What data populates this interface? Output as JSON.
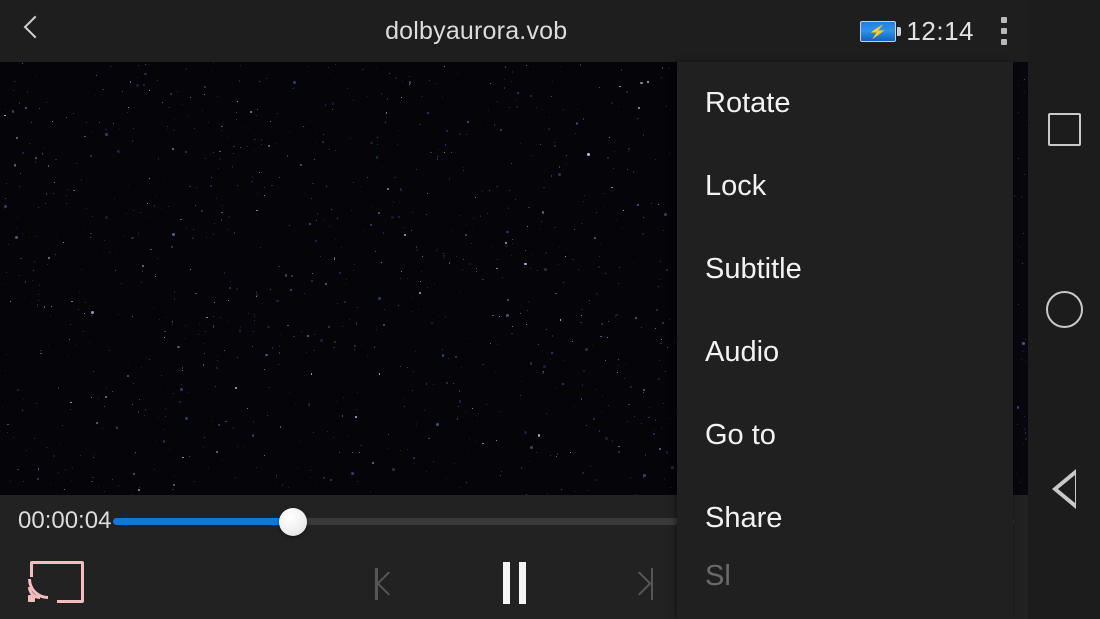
{
  "topbar": {
    "back_icon": "chevron-left-icon",
    "title": "dolbyaurora.vob",
    "battery_icon": "battery-charging-icon",
    "battery_bolt": "⚡",
    "clock": "12:14",
    "overflow_icon": "kebab-menu-icon"
  },
  "player": {
    "current_time": "00:00:04",
    "progress_percent": 20,
    "cast_icon": "cast-icon",
    "previous_icon": "skip-previous-icon",
    "pause_icon": "pause-icon",
    "next_icon": "skip-next-icon",
    "accent_color": "#1278d4",
    "cast_color": "#f3bdbd"
  },
  "menu": {
    "items": [
      {
        "label": "Rotate"
      },
      {
        "label": "Lock"
      },
      {
        "label": "Subtitle"
      },
      {
        "label": "Audio"
      },
      {
        "label": "Go to"
      },
      {
        "label": "Share"
      },
      {
        "label": "Sl"
      }
    ]
  },
  "navbar": {
    "recents_icon": "square-recents-icon",
    "home_icon": "circle-home-icon",
    "back_icon": "triangle-back-icon"
  },
  "colors": {
    "topbar_bg": "#1e1e1e",
    "bottombar_bg": "#222222",
    "menu_bg": "#202020",
    "navbar_bg": "#1c1c1c",
    "video_bg": "#050509"
  }
}
